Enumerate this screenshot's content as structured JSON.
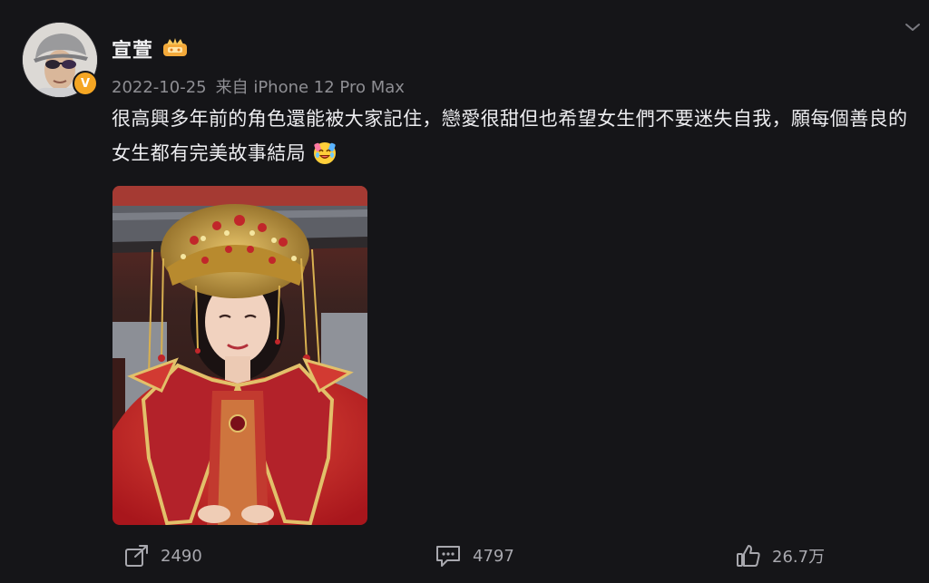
{
  "post": {
    "author": {
      "name": "宣萱",
      "verified": true,
      "badge_icon": "crown-badge-icon",
      "verified_icon": "verified-v-icon"
    },
    "date": "2022-10-25",
    "source": "来自 iPhone 12 Pro Max",
    "text": "很高興多年前的角色還能被大家記住，戀愛很甜但也希望女生們不要迷失自我，願每個善良的女生都有完美故事結局",
    "emoji": "crying-laughing-emoji-icon",
    "image_alt": "woman-in-red-bridal-costume-photo"
  },
  "actions": {
    "repost_count": "2490",
    "comment_count": "4797",
    "like_count": "26.7万"
  },
  "colors": {
    "background": "#151518",
    "text_primary": "#ededf0",
    "text_secondary": "#8e8e93",
    "verified": "#f5a623"
  }
}
